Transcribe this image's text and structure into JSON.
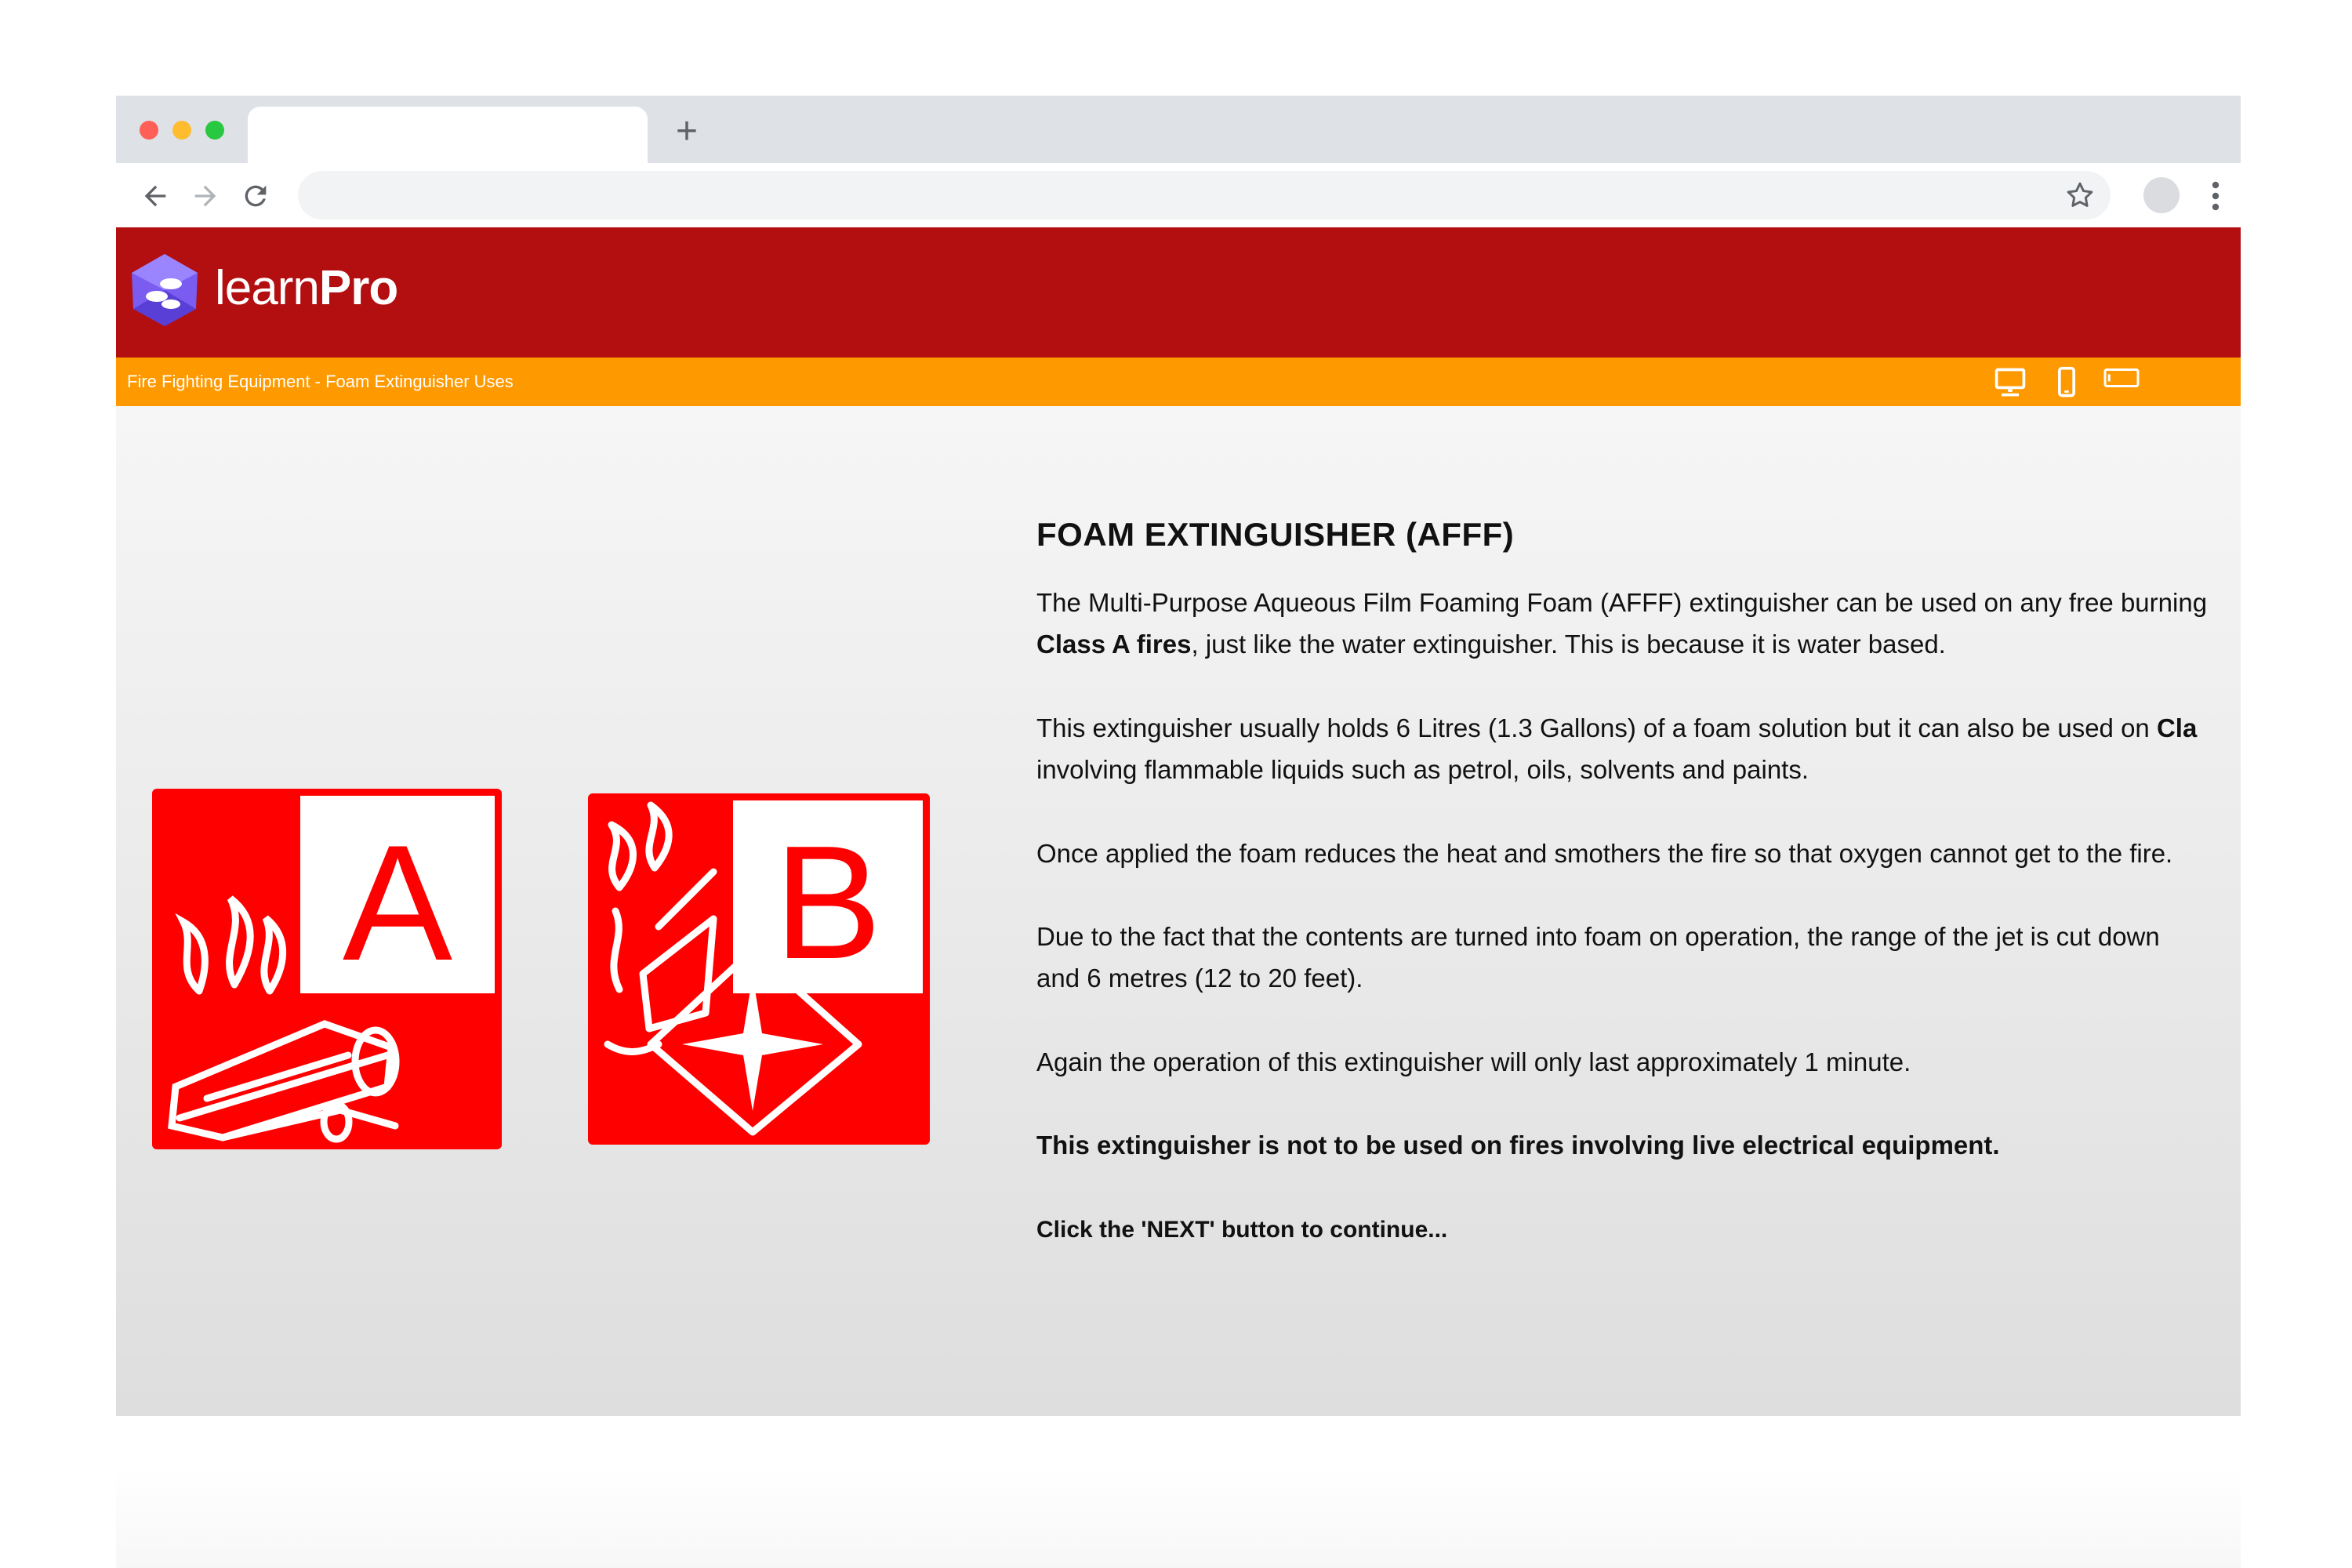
{
  "browser": {
    "new_tab_glyph": "+",
    "icons": [
      "back-arrow-icon",
      "forward-arrow-icon",
      "reload-icon",
      "star-icon",
      "profile-avatar",
      "kebab-menu-icon"
    ]
  },
  "app": {
    "logo_light": "learn",
    "logo_bold": "Pro",
    "header_color": "#b30e10",
    "accent_color": "#ff9900",
    "breadcrumb": "Fire Fighting Equipment - Foam Extinguisher Uses",
    "device_icons": [
      "desktop-icon",
      "mobile-icon",
      "tablet-icon"
    ]
  },
  "signs": [
    {
      "letter": "A",
      "pictogram": "burning-wood-icon",
      "color": "#ff0000"
    },
    {
      "letter": "B",
      "pictogram": "burning-liquid-icon",
      "color": "#ff0000"
    }
  ],
  "content": {
    "title": "FOAM EXTINGUISHER (AFFF)",
    "p1_line1": "The Multi-Purpose Aqueous Film Foaming Foam (AFFF) extinguisher can be used on any free burning",
    "p1_bold": "Class A fires",
    "p1_rest": ", just like the water extinguisher. This is because it is water based.",
    "p2_line1": "This extinguisher usually holds 6 Litres (1.3 Gallons) of a foam solution but it can also be used on ",
    "p2_bold": "Cla",
    "p2_line2": "involving flammable liquids such as petrol, oils, solvents and paints.",
    "p3": "Once applied the foam reduces the heat and smothers the fire so that oxygen cannot get to the fire.",
    "p4_line1": "Due to the fact that the contents are turned into foam on operation, the range of the jet is cut down",
    "p4_line2": "and 6 metres (12 to 20 feet).",
    "p5": "Again the operation of this extinguisher will only last approximately 1 minute.",
    "warning": "This extinguisher is not to be used on fires involving live electrical equipment.",
    "next_hint": "Click the 'NEXT' button to continue..."
  }
}
